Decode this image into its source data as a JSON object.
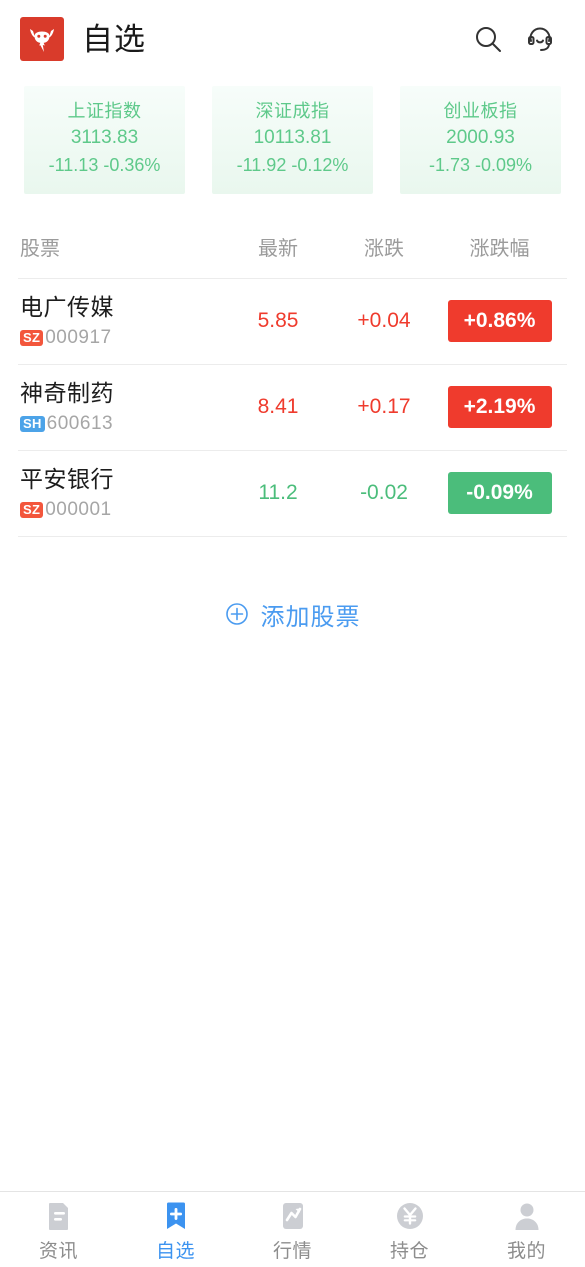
{
  "header": {
    "logo_icon": "bull-logo-icon",
    "logo_color": "#d93b2b",
    "title": "自选",
    "search_icon": "search-icon",
    "support_icon": "customer-service-icon"
  },
  "indices": [
    {
      "name": "上证指数",
      "value": "3113.83",
      "change": "-11.13 -0.36%",
      "direction": "down"
    },
    {
      "name": "深证成指",
      "value": "10113.81",
      "change": "-11.92 -0.12%",
      "direction": "down"
    },
    {
      "name": "创业板指",
      "value": "2000.93",
      "change": "-1.73 -0.09%",
      "direction": "down"
    }
  ],
  "table": {
    "columns": {
      "name": "股票",
      "last": "最新",
      "change": "涨跌",
      "percent": "涨跌幅"
    },
    "rows": [
      {
        "name": "电广传媒",
        "market": "SZ",
        "code": "000917",
        "last": "5.85",
        "change": "+0.04",
        "percent": "+0.86%",
        "direction": "up"
      },
      {
        "name": "神奇制药",
        "market": "SH",
        "code": "600613",
        "last": "8.41",
        "change": "+0.17",
        "percent": "+2.19%",
        "direction": "up"
      },
      {
        "name": "平安银行",
        "market": "SZ",
        "code": "000001",
        "last": "11.2",
        "change": "-0.02",
        "percent": "-0.09%",
        "direction": "down"
      }
    ]
  },
  "add_stock": {
    "label": "添加股票",
    "icon": "plus-circle-icon"
  },
  "bottom_nav": {
    "items": [
      {
        "label": "资讯",
        "icon": "news-document-icon",
        "active": false
      },
      {
        "label": "自选",
        "icon": "bookmark-plus-icon",
        "active": true
      },
      {
        "label": "行情",
        "icon": "trend-chart-icon",
        "active": false
      },
      {
        "label": "持仓",
        "icon": "yuan-circle-icon",
        "active": false
      },
      {
        "label": "我的",
        "icon": "person-icon",
        "active": false
      }
    ]
  },
  "colors": {
    "up": "#ef3b2d",
    "down": "#4bbd7b",
    "accent": "#3c93f0",
    "brand": "#d93b2b",
    "index_text": "#5ec98a"
  }
}
